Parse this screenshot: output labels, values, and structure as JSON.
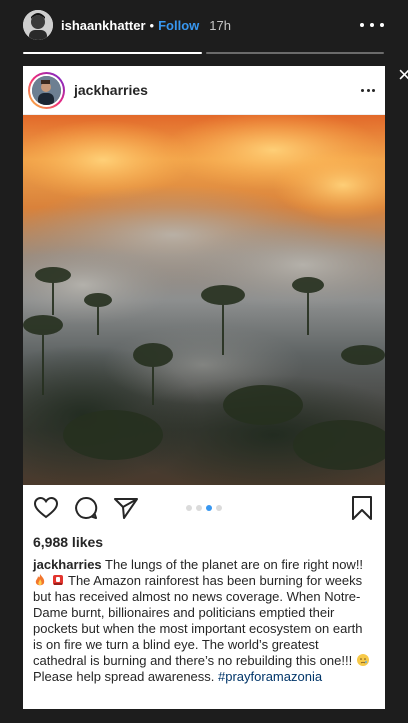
{
  "story": {
    "username": "ishaankhatter",
    "separator": "•",
    "follow_label": "Follow",
    "time": "17h",
    "progress_segments": 2,
    "progress_current": 1,
    "close_glyph": "×"
  },
  "post": {
    "username": "jackharries",
    "likes": "6,988 likes",
    "carousel_dots": 4,
    "carousel_active": 2,
    "caption_user": "jackharries",
    "caption_part1": " The lungs of the planet are on fire right now!! ",
    "caption_part2": " The Amazon rainforest has been burning for weeks but has received almost no news coverage. When Notre-Dame burnt, billionaires and politicians emptied their pockets but when the most important ecosystem on earth is on fire we turn a blind eye. The world’s greatest cathedral is burning and there’s no rebuilding this one!!! ",
    "caption_part3": " Please help spread awareness. ",
    "hashtag": "#prayforamazonia"
  },
  "icons": {
    "heart": "heart-icon",
    "comment": "comment-icon",
    "share": "send-icon",
    "bookmark": "bookmark-icon",
    "fire": "fire-emoji",
    "siren": "siren-emoji",
    "cry": "crying-face-emoji"
  },
  "colors": {
    "link": "#3897f0",
    "hashtag": "#003569",
    "background": "#1d1d1d"
  }
}
